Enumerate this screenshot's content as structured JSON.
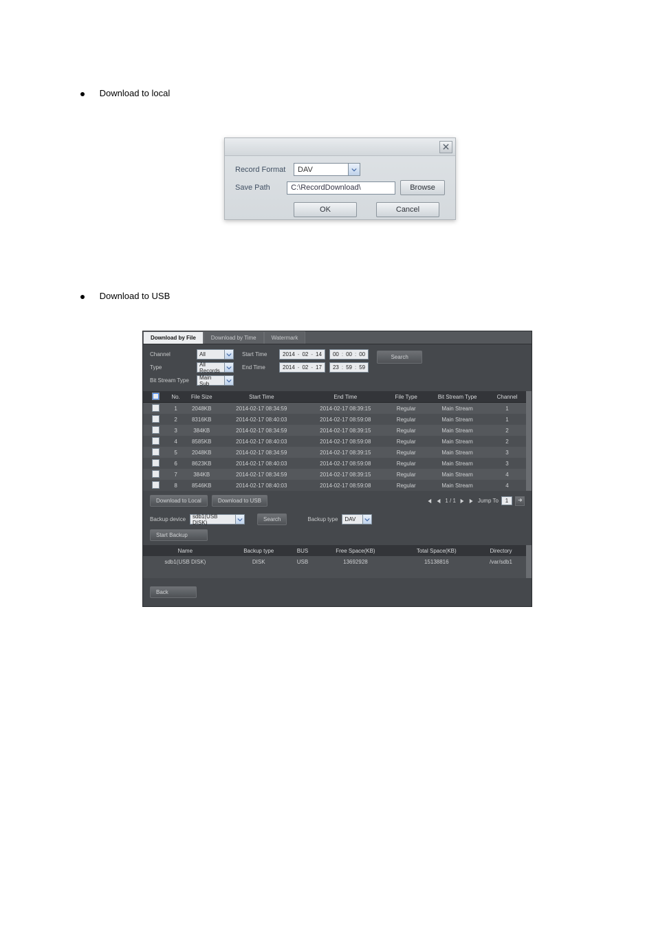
{
  "line1": "Download to local",
  "line1_tail": "",
  "line2": "Download to USB",
  "dialog1": {
    "record_format_label": "Record Format",
    "record_format_value": "DAV",
    "save_path_label": "Save Path",
    "save_path_value": "C:\\RecordDownload\\",
    "browse": "Browse",
    "ok": "OK",
    "cancel": "Cancel"
  },
  "panel": {
    "tabs": {
      "byfile": "Download by File",
      "bytime": "Download by Time",
      "watermark": "Watermark"
    },
    "filters": {
      "channel": "Channel",
      "type": "Type",
      "bitstream": "Bit Stream Type",
      "channel_v": "All",
      "type_v": "All Records",
      "bitstream_v": "Main Sub",
      "start_time": "Start Time",
      "end_time": "End Time",
      "sd_y": "2014",
      "sd_m": "02",
      "sd_d": "14",
      "st_h": "00",
      "st_m": "00",
      "st_s": "00",
      "ed_y": "2014",
      "ed_m": "02",
      "ed_d": "17",
      "et_h": "23",
      "et_m": "59",
      "et_s": "59",
      "search": "Search"
    },
    "cols": {
      "no": "No.",
      "size": "File Size",
      "start": "Start Time",
      "end": "End Time",
      "ft": "File Type",
      "bs": "Bit Stream Type",
      "ch": "Channel"
    },
    "rows": [
      {
        "no": "1",
        "size": "2048KB",
        "start": "2014-02-17 08:34:59",
        "end": "2014-02-17 08:39:15",
        "ft": "Regular",
        "bs": "Main Stream",
        "ch": "1"
      },
      {
        "no": "2",
        "size": "8316KB",
        "start": "2014-02-17 08:40:03",
        "end": "2014-02-17 08:59:08",
        "ft": "Regular",
        "bs": "Main Stream",
        "ch": "1"
      },
      {
        "no": "3",
        "size": "384KB",
        "start": "2014-02-17 08:34:59",
        "end": "2014-02-17 08:39:15",
        "ft": "Regular",
        "bs": "Main Stream",
        "ch": "2"
      },
      {
        "no": "4",
        "size": "8585KB",
        "start": "2014-02-17 08:40:03",
        "end": "2014-02-17 08:59:08",
        "ft": "Regular",
        "bs": "Main Stream",
        "ch": "2"
      },
      {
        "no": "5",
        "size": "2048KB",
        "start": "2014-02-17 08:34:59",
        "end": "2014-02-17 08:39:15",
        "ft": "Regular",
        "bs": "Main Stream",
        "ch": "3"
      },
      {
        "no": "6",
        "size": "8623KB",
        "start": "2014-02-17 08:40:03",
        "end": "2014-02-17 08:59:08",
        "ft": "Regular",
        "bs": "Main Stream",
        "ch": "3"
      },
      {
        "no": "7",
        "size": "384KB",
        "start": "2014-02-17 08:34:59",
        "end": "2014-02-17 08:39:15",
        "ft": "Regular",
        "bs": "Main Stream",
        "ch": "4"
      },
      {
        "no": "8",
        "size": "8546KB",
        "start": "2014-02-17 08:40:03",
        "end": "2014-02-17 08:59:08",
        "ft": "Regular",
        "bs": "Main Stream",
        "ch": "4"
      }
    ],
    "dl_local": "Download to Local",
    "dl_usb": "Download to USB",
    "pager": {
      "text": "1 / 1",
      "jump": "Jump To",
      "page": "1"
    },
    "backup": {
      "device_label": "Backup device",
      "device_value": "sdb1(USB DISK)",
      "search": "Search",
      "type_label": "Backup type",
      "type_value": "DAV",
      "start": "Start Backup"
    },
    "devcols": {
      "name": "Name",
      "bt": "Backup type",
      "bus": "BUS",
      "free": "Free Space(KB)",
      "total": "Total Space(KB)",
      "dir": "Directory"
    },
    "devrow": {
      "name": "sdb1(USB DISK)",
      "bt": "DISK",
      "bus": "USB",
      "free": "13692928",
      "total": "15138816",
      "dir": "/var/sdb1"
    },
    "back": "Back"
  }
}
